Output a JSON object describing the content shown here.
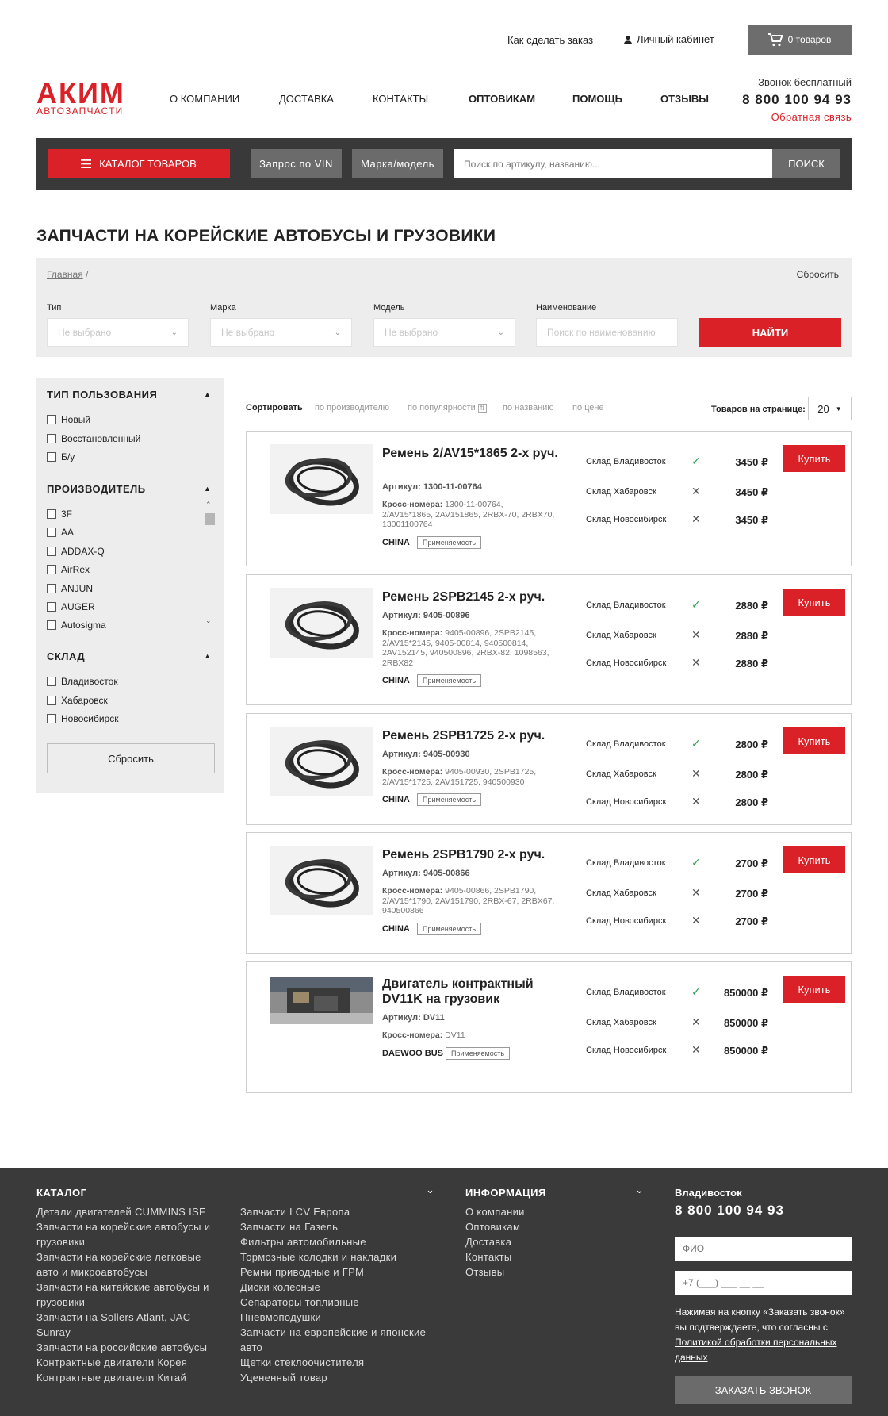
{
  "header": {
    "how_to_order": "Как сделать заказ",
    "account": "Личный кабинет",
    "cart": "0 товаров",
    "logo_main": "АКИМ",
    "logo_sub": "АВТОЗАПЧАСТИ",
    "nav": [
      "О КОМПАНИИ",
      "ДОСТАВКА",
      "КОНТАКТЫ",
      "ОПТОВИКАМ",
      "ПОМОЩЬ",
      "ОТЗЫВЫ"
    ],
    "free_call": "Звонок бесплатный",
    "phone": "8 800 100 94 93",
    "feedback": "Обратная связь"
  },
  "searchbar": {
    "catalog": "КАТАЛОГ ТОВАРОВ",
    "vin": "Запрос по VIN",
    "make_model": "Марка/модель",
    "placeholder": "Поиск по артикулу, названию...",
    "search": "ПОИСК"
  },
  "page": {
    "title": "ЗАПЧАСТИ НА КОРЕЙСКИЕ АВТОБУСЫ И ГРУЗОВИКИ",
    "breadcrumb_home": "Главная",
    "breadcrumb_sep": "/",
    "reset": "Сбросить"
  },
  "filters": {
    "labels": [
      "Тип",
      "Марка",
      "Модель",
      "Наименование"
    ],
    "placeholders": [
      "Не выбрано",
      "Не выбрано",
      "Не выбрано",
      "Поиск по наименованию"
    ],
    "find": "НАЙТИ"
  },
  "sidebar": {
    "use_type_title": "ТИП ПОЛЬЗОВАНИЯ",
    "use_types": [
      "Новый",
      "Восстановленный",
      "Б/у"
    ],
    "maker_title": "ПРОИЗВОДИТЕЛЬ",
    "makers": [
      "3F",
      "AA",
      "ADDAX-Q",
      "AirRex",
      "ANJUN",
      "AUGER",
      "Autosigma"
    ],
    "warehouse_title": "СКЛАД",
    "warehouses": [
      "Владивосток",
      "Хабаровск",
      "Новосибирск"
    ],
    "reset": "Сбросить"
  },
  "sort": {
    "label": "Сортировать",
    "options": [
      "по производителю",
      "по популярности",
      "по названию",
      "по цене"
    ],
    "per_page_label": "Товаров на странице:",
    "per_page": "20"
  },
  "products": [
    {
      "name": "Ремень 2/AV15*1865 2-х руч.",
      "article_label": "Артикул:",
      "article": "1300-11-00764",
      "cross_label": "Кросс-номера:",
      "cross": "1300-11-00764, 2/AV15*1865, 2AV151865, 2RBX-70, 2RBX70, 13001100764",
      "brand": "CHINA",
      "applic": "Применяемость",
      "stocks": [
        {
          "name": "Склад Владивосток",
          "available": true,
          "price": "3450 ₽"
        },
        {
          "name": "Склад Хабаровск",
          "available": false,
          "price": "3450 ₽"
        },
        {
          "name": "Склад Новосибирск",
          "available": false,
          "price": "3450 ₽"
        }
      ],
      "buy": "Купить"
    },
    {
      "name": "Ремень 2SPB2145 2-х руч.",
      "article_label": "Артикул:",
      "article": "9405-00896",
      "cross_label": "Кросс-номера:",
      "cross": "9405-00896, 2SPB2145, 2/AV15*2145, 9405-00814, 940500814, 2AV152145, 940500896, 2RBX-82, 1098563, 2RBX82",
      "brand": "CHINA",
      "applic": "Применяемость",
      "stocks": [
        {
          "name": "Склад Владивосток",
          "available": true,
          "price": "2880 ₽"
        },
        {
          "name": "Склад Хабаровск",
          "available": false,
          "price": "2880 ₽"
        },
        {
          "name": "Склад Новосибирск",
          "available": false,
          "price": "2880 ₽"
        }
      ],
      "buy": "Купить"
    },
    {
      "name": "Ремень 2SPB1725 2-х руч.",
      "article_label": "Артикул:",
      "article": "9405-00930",
      "cross_label": "Кросс-номера:",
      "cross": "9405-00930, 2SPB1725, 2/AV15*1725, 2AV151725, 940500930",
      "brand": "CHINA",
      "applic": "Применяемость",
      "stocks": [
        {
          "name": "Склад Владивосток",
          "available": true,
          "price": "2800 ₽"
        },
        {
          "name": "Склад Хабаровск",
          "available": false,
          "price": "2800 ₽"
        },
        {
          "name": "Склад Новосибирск",
          "available": false,
          "price": "2800 ₽"
        }
      ],
      "buy": "Купить"
    },
    {
      "name": "Ремень 2SPB1790 2-х руч.",
      "article_label": "Артикул:",
      "article": "9405-00866",
      "cross_label": "Кросс-номера:",
      "cross": "9405-00866, 2SPB1790, 2/AV15*1790, 2AV151790, 2RBX-67, 2RBX67, 940500866",
      "brand": "CHINA",
      "applic": "Применяемость",
      "stocks": [
        {
          "name": "Склад Владивосток",
          "available": true,
          "price": "2700 ₽"
        },
        {
          "name": "Склад Хабаровск",
          "available": false,
          "price": "2700 ₽"
        },
        {
          "name": "Склад Новосибирск",
          "available": false,
          "price": "2700 ₽"
        }
      ],
      "buy": "Купить"
    },
    {
      "name": "Двигатель контрактный DV11K на грузовик",
      "article_label": "Артикул:",
      "article": "DV11",
      "cross_label": "Кросс-номера:",
      "cross": "DV11",
      "brand": "DAEWOO BUS",
      "applic": "Применяемость",
      "stocks": [
        {
          "name": "Склад Владивосток",
          "available": true,
          "price": "850000 ₽"
        },
        {
          "name": "Склад Хабаровск",
          "available": false,
          "price": "850000 ₽"
        },
        {
          "name": "Склад Новосибирск",
          "available": false,
          "price": "850000 ₽"
        }
      ],
      "buy": "Купить"
    }
  ],
  "footer": {
    "catalog_title": "КАТАЛОГ",
    "catalog_col1": [
      "Детали двигателей CUMMINS ISF",
      "Запчасти на корейские автобусы и грузовики",
      "Запчасти на корейские легковые авто и микроавтобусы",
      "Запчасти на китайские автобусы и грузовики",
      "Запчасти на Sollers Atlant, JAC Sunray",
      "Запчасти на российские автобусы",
      "Контрактные двигатели Корея",
      "Контрактные двигатели Китай"
    ],
    "catalog_col2": [
      "Запчасти LCV Европа",
      "Запчасти на Газель",
      "Фильтры автомобильные",
      "Тормозные колодки и накладки",
      "Ремни приводные и ГРМ",
      "Диски колесные",
      "Сепараторы топливные",
      "Пневмоподушки",
      "Запчасти на европейские и японские авто",
      "Щетки стеклоочистителя",
      "Уцененный товар"
    ],
    "info_title": "ИНФОРМАЦИЯ",
    "info_items": [
      "О компании",
      "Оптовикам",
      "Доставка",
      "Контакты",
      "Отзывы"
    ],
    "city": "Владивосток",
    "phone": "8 800 100 94 93",
    "name_placeholder": "ФИО",
    "phone_placeholder": "+7 (___) ___ __ __",
    "note_start": "Нажимая на кнопку «Заказать звонок» вы подтверждаете, что согласны с ",
    "note_link": "Политикой обработки персональных данных",
    "call_button": "ЗАКАЗАТЬ ЗВОНОК"
  }
}
